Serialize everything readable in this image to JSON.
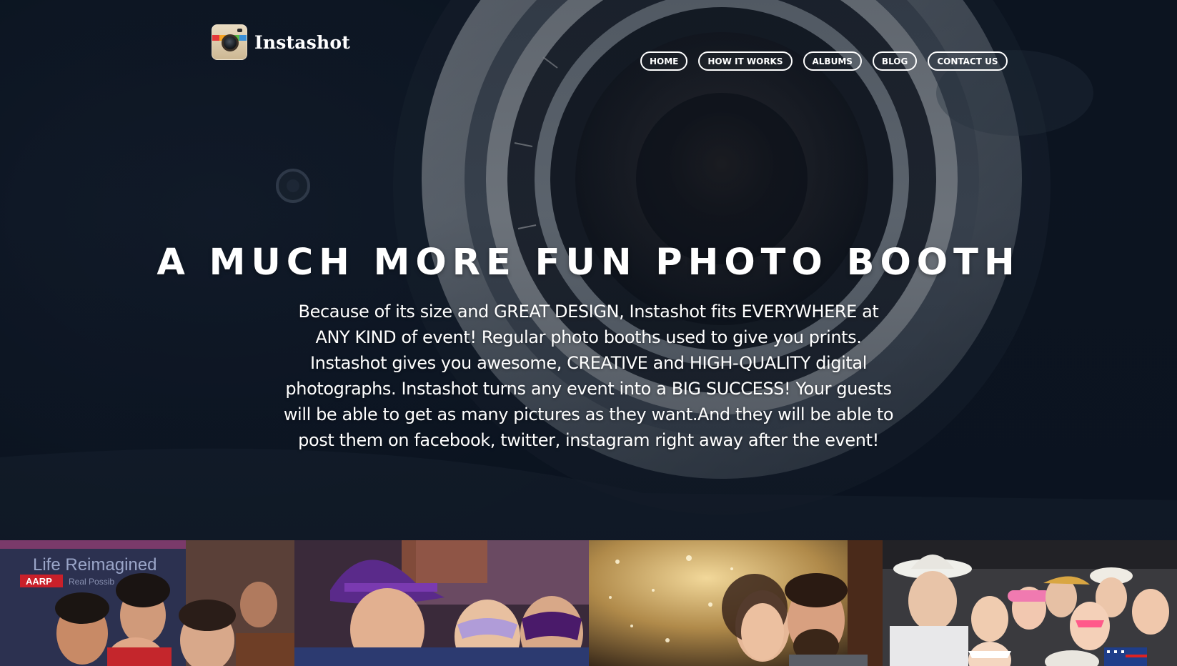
{
  "brand": {
    "name": "Instashot",
    "logo_icon": "camera-app-icon"
  },
  "nav": {
    "items": [
      {
        "label": "HOME",
        "active": true
      },
      {
        "label": "HOW IT WORKS"
      },
      {
        "label": "ALBUMS"
      },
      {
        "label": "BLOG"
      },
      {
        "label": "CONTACT US"
      }
    ]
  },
  "hero": {
    "headline": "A MUCH MORE FUN PHOTO BOOTH",
    "intro": "Because of its size and GREAT DESIGN, Instashot fits EVERYWHERE at ANY KIND of event! Regular photo booths used to give you prints. Instashot gives you awesome, CREATIVE and HIGH-QUALITY digital photographs. Instashot turns any event into a BIG SUCCESS! Your guests will be able to get as many pictures as they want.And they will be able to post them on facebook, twitter, instagram right away after the event!",
    "background": "vintage-camera-lens-photo"
  },
  "gallery": {
    "tiles": [
      {
        "subject": "group-photo-banner",
        "banner_text": "Life Reimagined",
        "banner_brand": "AARP",
        "banner_sub": "Real Possib"
      },
      {
        "subject": "masquerade-party-photo"
      },
      {
        "subject": "couple-sparkle-backdrop-photo"
      },
      {
        "subject": "group-props-photo"
      }
    ]
  },
  "colors": {
    "background": "#0d1626",
    "text": "#ffffff",
    "logo_stripes": [
      "#e5383b",
      "#f4a222",
      "#f2d531",
      "#58b947",
      "#3a8fd8"
    ]
  }
}
